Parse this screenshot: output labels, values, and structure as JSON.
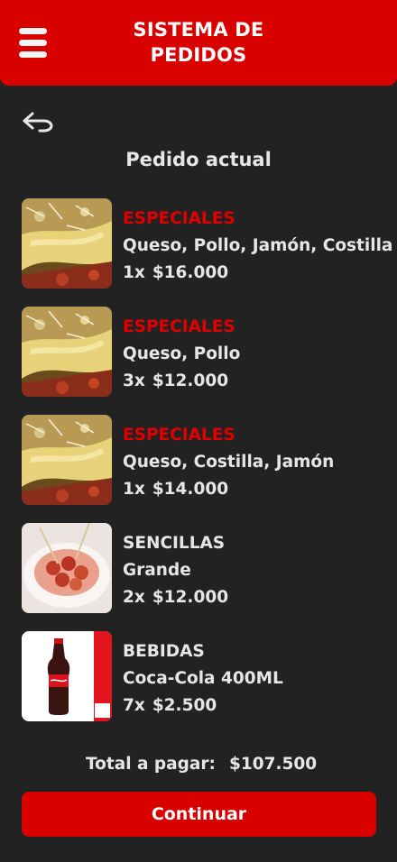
{
  "header": {
    "title_line1": "SISTEMA DE",
    "title_line2": "PEDIDOS",
    "menu_icon": "hamburger-menu-icon",
    "accent_color": "#d90000"
  },
  "nav": {
    "back_icon": "back-arrow-icon"
  },
  "page": {
    "title": "Pedido actual"
  },
  "order_items": [
    {
      "category": "ESPECIALES",
      "detail": "Queso, Pollo, Jamón, Costilla",
      "quantity": "1x",
      "price": "$16.000",
      "image": "salchipapa-especial"
    },
    {
      "category": "ESPECIALES",
      "detail": "Queso, Pollo",
      "quantity": "3x",
      "price": "$12.000",
      "image": "salchipapa-especial"
    },
    {
      "category": "ESPECIALES",
      "detail": "Queso, Costilla, Jamón",
      "quantity": "1x",
      "price": "$14.000",
      "image": "salchipapa-especial"
    },
    {
      "category": "SENCILLAS",
      "detail": "Grande",
      "quantity": "2x",
      "price": "$12.000",
      "image": "salchipapa-sencilla"
    },
    {
      "category": "BEBIDAS",
      "detail": "Coca-Cola 400ML",
      "quantity": "7x",
      "price": "$2.500",
      "image": "coca-cola-bottle"
    }
  ],
  "summary": {
    "total_label": "Total a pagar:",
    "total_value": "$107.500"
  },
  "actions": {
    "continue_label": "Continuar"
  }
}
